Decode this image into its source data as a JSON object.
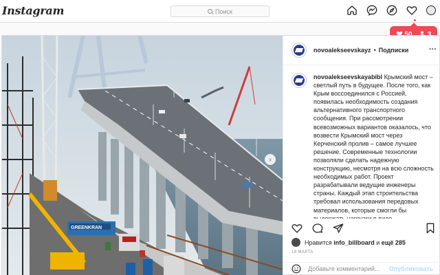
{
  "header": {
    "logo_text": "Instagram",
    "search_placeholder": "Поиск",
    "nav_icons": [
      "home-icon",
      "messenger-icon",
      "explore-icon",
      "heart-icon",
      "profile-avatar"
    ]
  },
  "notification": {
    "likes_count": "50",
    "followers_count": "3"
  },
  "post": {
    "username": "novoalekseevskayz",
    "follow_label": "Подписки",
    "caption_username": "novoalekseevskayabibl",
    "caption_text": "Крымский мост – светлый путь в будущее. После того, как Крым воссоединился с Россией, появилась необходимость создания альтернативного транспортного сообщения. При рассмотрении всевозможных вариантов оказалось, что возвести Крымский мост через Керченский пролив – самое лучшее решение. Современные технологии позволяли сделать надежную конструкцию, несмотря на всю сложность необходимых работ. Проект разрабатывали ведущие инженеры страны. Каждый этап строительства требовал использования передовых материалов, которые смогли бы выдержать нагрузки в виде",
    "likes_prefix": "Нравится",
    "liked_by": "info_billboard",
    "likes_connector": "и",
    "likes_others": "ещё 285",
    "date": "18 МАРТА",
    "comment_placeholder": "Добавьте комментарий...",
    "publish_label": "Опубликовать",
    "photo_sign_text": "GREENKRAN"
  },
  "colors": {
    "accent_red": "#ed4956",
    "publish_blue": "#b2dffc",
    "border": "#dbdbdb"
  }
}
